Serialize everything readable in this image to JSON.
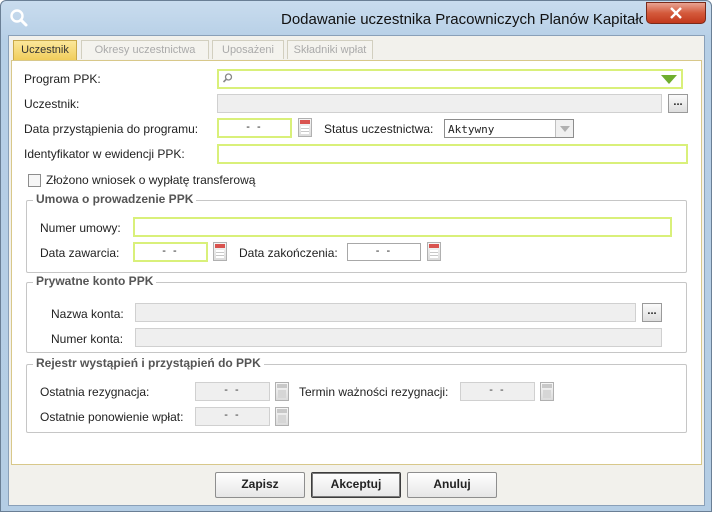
{
  "window": {
    "title": "Dodawanie uczestnika Pracowniczych Planów Kapitało...",
    "close_label": "✕"
  },
  "tabs": [
    {
      "label": "Uczestnik",
      "active": true
    },
    {
      "label": "Okresy uczestnictwa",
      "active": false
    },
    {
      "label": "Uposażeni",
      "active": false
    },
    {
      "label": "Składniki wpłat",
      "active": false
    }
  ],
  "form": {
    "program_label": "Program PPK:",
    "program_value": "",
    "uczestnik_label": "Uczestnik:",
    "uczestnik_value": "",
    "uczestnik_browse": "...",
    "data_przystapienia_label": "Data przystąpienia do programu:",
    "data_przystapienia_value": "- -",
    "status_label": "Status uczestnictwa:",
    "status_value": "Aktywny",
    "identyfikator_label": "Identyfikator w ewidencji PPK:",
    "identyfikator_value": "",
    "transfer_checkbox_label": "Złożono wniosek o wypłatę transferową",
    "transfer_checked": false
  },
  "umowa": {
    "title": "Umowa o prowadzenie PPK",
    "numer_label": "Numer umowy:",
    "numer_value": "",
    "data_zawarcia_label": "Data zawarcia:",
    "data_zawarcia_value": "- -",
    "data_zakonczenia_label": "Data zakończenia:",
    "data_zakonczenia_value": "- -"
  },
  "konto": {
    "title": "Prywatne konto PPK",
    "nazwa_label": "Nazwa konta:",
    "nazwa_value": "",
    "nazwa_browse": "...",
    "numer_label": "Numer konta:",
    "numer_value": ""
  },
  "rejestr": {
    "title": "Rejestr wystąpień i przystąpień do PPK",
    "ostatnia_rezygnacja_label": "Ostatnia rezygnacja:",
    "ostatnia_rezygnacja_value": "- -",
    "termin_label": "Termin ważności rezygnacji:",
    "termin_value": "- -",
    "ponowienie_label": "Ostatnie ponowienie wpłat:",
    "ponowienie_value": "- -"
  },
  "buttons": {
    "save": "Zapisz",
    "accept": "Akceptuj",
    "cancel": "Anuluj"
  },
  "colors": {
    "field_highlight": "#d9f07a",
    "tab_active": "#f0cc58",
    "close_button": "#d45a3c"
  }
}
